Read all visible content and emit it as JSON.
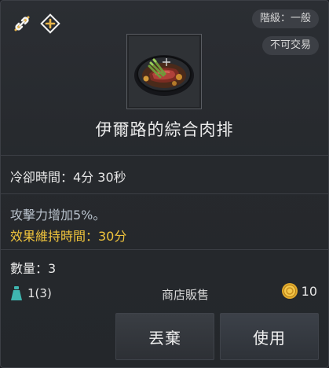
{
  "header": {
    "grade_label": "階級：一般",
    "trade_label": "不可交易",
    "icons": [
      "link-icon",
      "compare-icon"
    ]
  },
  "item": {
    "name": "伊爾路的綜合肉排",
    "icon": "steak-dish-icon"
  },
  "stats": {
    "cooldown": "冷卻時間：4分 30秒",
    "effect": "攻擊力增加5%。",
    "duration": "效果維持時間：30分",
    "quantity": "數量：3"
  },
  "footer": {
    "weight": "1(3)",
    "shop_label": "商店販售",
    "price": "10",
    "colors": {
      "weight_icon": "#3fb6b0",
      "coin": "#e0a92c",
      "duration_text": "#f0c43c"
    }
  },
  "buttons": {
    "discard": "丟棄",
    "use": "使用"
  }
}
